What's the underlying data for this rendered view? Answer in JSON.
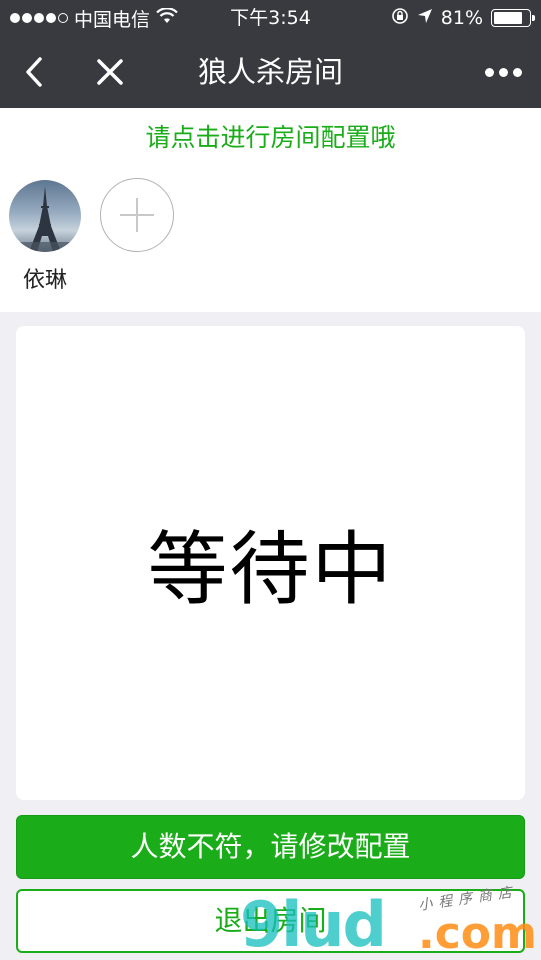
{
  "status_bar": {
    "carrier": "中国电信",
    "time": "下午3:54",
    "battery_percent": "81%",
    "battery_level": 0.81,
    "signal_bars_filled": 4,
    "signal_bars_total": 5
  },
  "nav": {
    "title": "狼人杀房间",
    "back_icon": "chevron-left-icon",
    "close_icon": "close-icon",
    "more_icon": "more-dots-icon"
  },
  "config": {
    "hint": "请点击进行房间配置哦"
  },
  "players": [
    {
      "name": "依琳",
      "avatar": "eiffel-tower-avatar"
    }
  ],
  "add_player_icon": "plus-icon",
  "waiting": {
    "text": "等待中"
  },
  "buttons": {
    "primary": "人数不符，请修改配置",
    "secondary": "退出房间"
  },
  "watermark": {
    "main": "9lud",
    "suffix": ".com",
    "small": "小程序商店"
  },
  "colors": {
    "nav_bg": "#393a3f",
    "accent_green": "#1aad19",
    "page_bg": "#efeff4"
  }
}
